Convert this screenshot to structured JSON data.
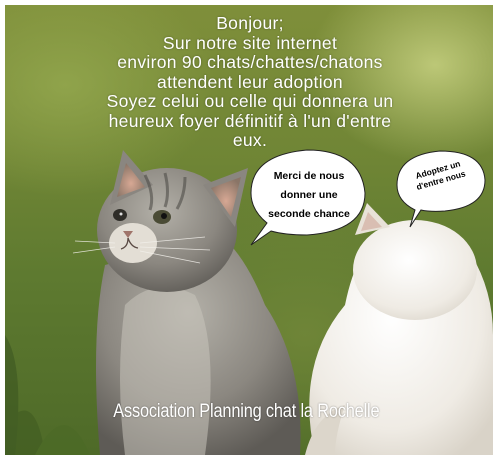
{
  "headline": {
    "lines": [
      "Bonjour;",
      "Sur notre site internet",
      "environ 90 chats/chattes/chatons",
      "attendent leur adoption",
      "Soyez celui ou celle qui donnera un",
      "heureux  foyer définitif à l'un d'entre",
      "eux."
    ]
  },
  "bubbles": {
    "left": {
      "lines": [
        "Merci de nous",
        "donner une",
        "seconde chance"
      ]
    },
    "right": {
      "lines": [
        "Adoptez un",
        "d'entre nous"
      ]
    }
  },
  "footer": {
    "text": "Association Planning chat la Rochelle"
  },
  "colors": {
    "text": "#ffffff",
    "bubble_fill": "#ffffff",
    "bubble_text": "#000000",
    "background_green": "#6f8535",
    "tabby_fur": "#8f8c86",
    "white_cat_fur": "#f4f1ec"
  }
}
